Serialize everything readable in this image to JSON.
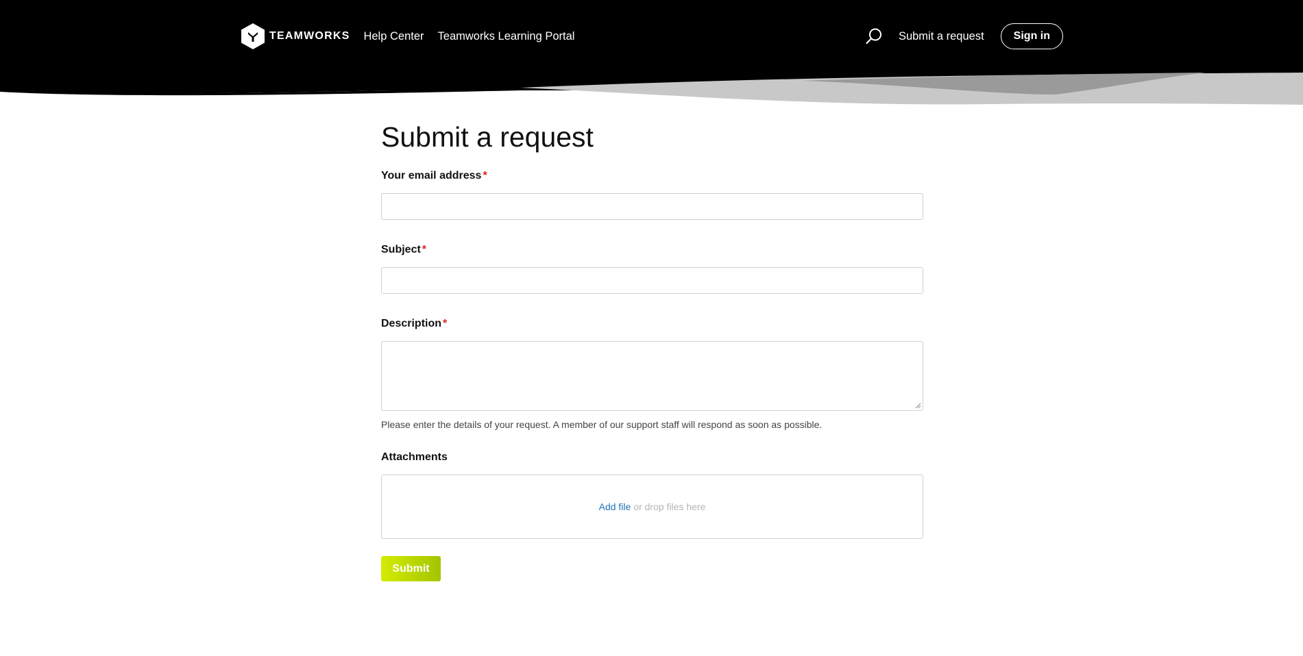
{
  "header": {
    "brand": "TEAMWORKS",
    "nav": [
      {
        "label": "Help Center"
      },
      {
        "label": "Teamworks Learning Portal"
      }
    ],
    "submit_request_label": "Submit a request",
    "sign_in_label": "Sign in"
  },
  "form": {
    "title": "Submit a request",
    "email": {
      "label": "Your email address",
      "required": "*",
      "value": ""
    },
    "subject": {
      "label": "Subject",
      "required": "*",
      "value": ""
    },
    "description": {
      "label": "Description",
      "required": "*",
      "value": "",
      "hint": "Please enter the details of your request. A member of our support staff will respond as soon as possible."
    },
    "attachments": {
      "label": "Attachments",
      "add_file": "Add file",
      "drop_text": "or drop files here"
    },
    "submit_label": "Submit"
  },
  "colors": {
    "header_bg": "#000000",
    "accent": "#c4e000",
    "required": "#e02020",
    "link": "#1f73b7"
  }
}
